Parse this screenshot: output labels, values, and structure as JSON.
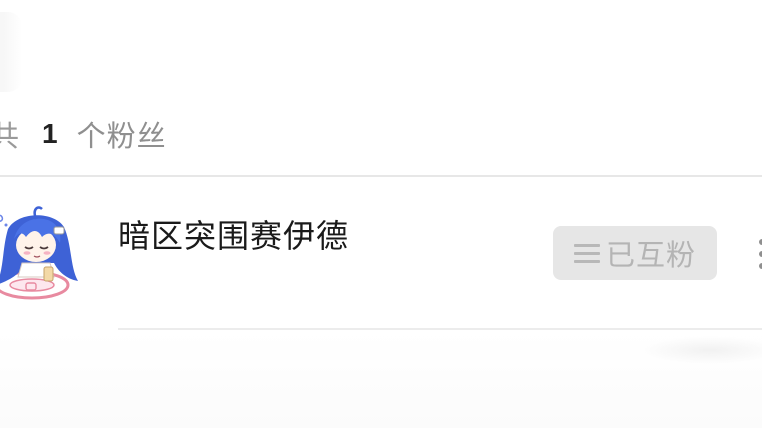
{
  "summary": {
    "prefix": "共",
    "count": "1",
    "suffix": "个粉丝"
  },
  "fans": [
    {
      "name": "暗区突围赛伊德",
      "avatar_icon": "anime-girl-avatar-icon",
      "status_icon": "menu-lines-icon",
      "status_label": "已互粉",
      "more_icon": "more-dots-icon"
    }
  ],
  "colors": {
    "background": "#ffffff",
    "divider": "#e7e7e7",
    "button_bg": "#e6e6e6",
    "button_text": "#b4b4b4",
    "count_text": "#9a9a9a",
    "name_text": "#1a1a1a",
    "avatar_hair": "#3e62d6"
  }
}
